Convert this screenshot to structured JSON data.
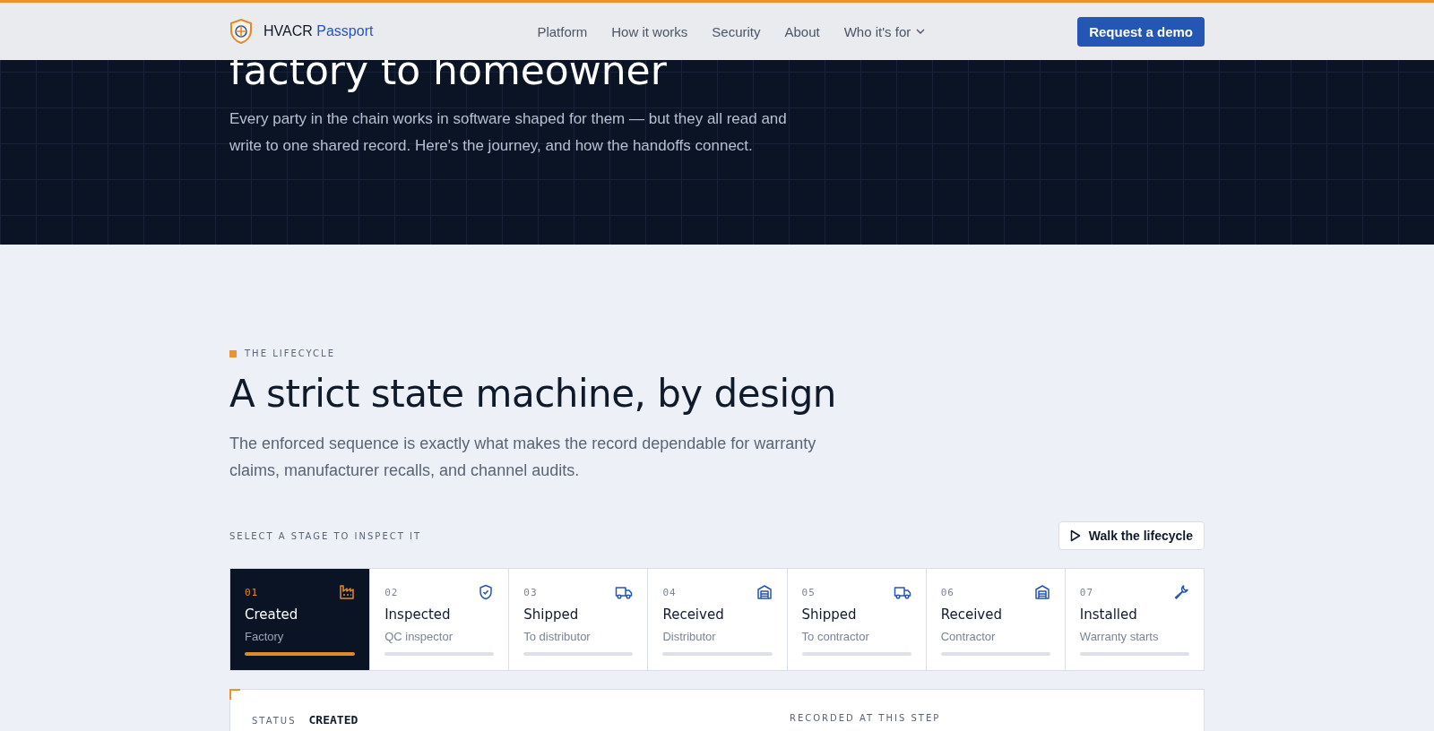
{
  "header": {
    "brand": "HVACR",
    "brand_accent": "Passport",
    "nav": [
      {
        "label": "Platform",
        "dropdown": false
      },
      {
        "label": "How it works",
        "dropdown": false
      },
      {
        "label": "Security",
        "dropdown": false
      },
      {
        "label": "About",
        "dropdown": false
      },
      {
        "label": "Who it's for",
        "dropdown": true
      }
    ],
    "cta": "Request a demo"
  },
  "hero": {
    "heading": "factory to homeowner",
    "text": "Every party in the chain works in software shaped for them — but they all read and write to one shared record. Here's the journey, and how the handoffs connect."
  },
  "lifecycle": {
    "eyebrow": "THE LIFECYCLE",
    "heading": "A strict state machine, by design",
    "text": "The enforced sequence is exactly what makes the record dependable for warranty claims, manufacturer recalls, and channel audits.",
    "prompt": "SELECT A STAGE TO INSPECT IT",
    "walk_button": "Walk the lifecycle",
    "stages": [
      {
        "number": "01",
        "title": "Created",
        "subtitle": "Factory",
        "kind": "factory",
        "selected": true
      },
      {
        "number": "02",
        "title": "Inspected",
        "subtitle": "QC inspector",
        "kind": "shield",
        "selected": false
      },
      {
        "number": "03",
        "title": "Shipped",
        "subtitle": "To distributor",
        "kind": "truck",
        "selected": false
      },
      {
        "number": "04",
        "title": "Received",
        "subtitle": "Distributor",
        "kind": "warehouse",
        "selected": false
      },
      {
        "number": "05",
        "title": "Shipped",
        "subtitle": "To contractor",
        "kind": "truck",
        "selected": false
      },
      {
        "number": "06",
        "title": "Received",
        "subtitle": "Contractor",
        "kind": "warehouse",
        "selected": false
      },
      {
        "number": "07",
        "title": "Installed",
        "subtitle": "Warranty starts",
        "kind": "wrench",
        "selected": false
      }
    ],
    "detail": {
      "status_label": "STATUS",
      "status": "CREATED",
      "recorded_label": "RECORDED AT THIS STEP"
    }
  }
}
